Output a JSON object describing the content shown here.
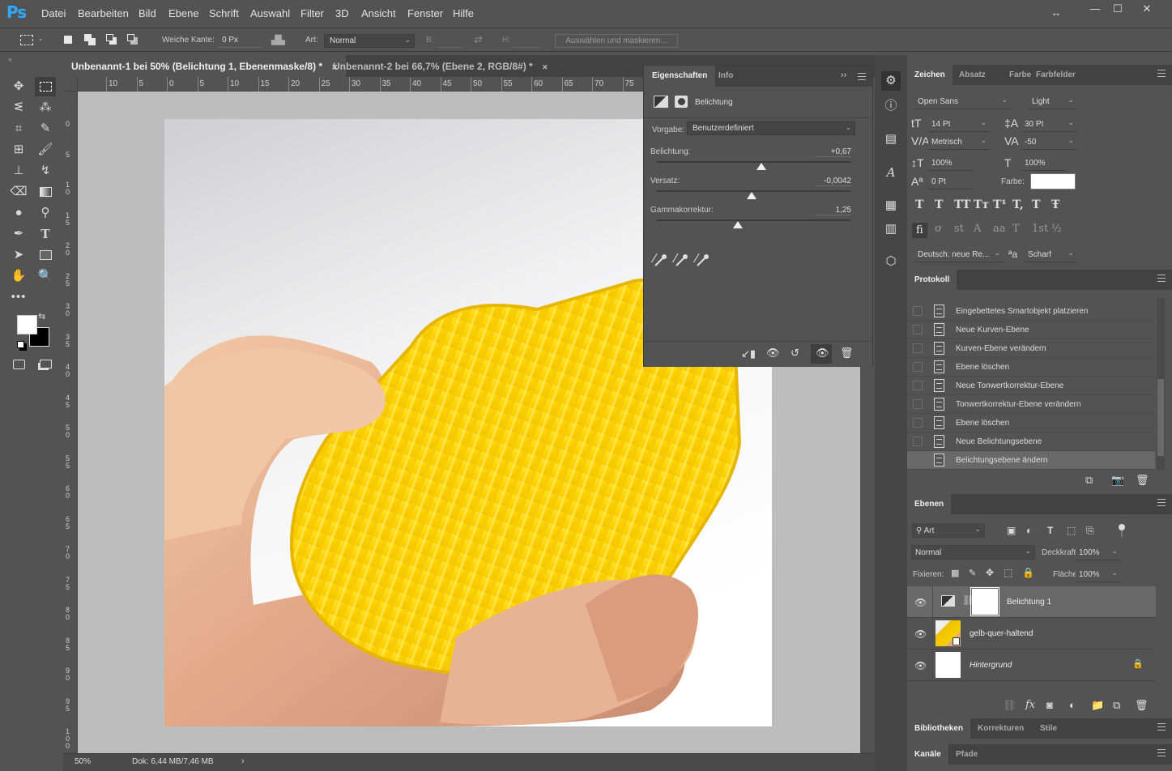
{
  "app": {
    "logo": "Ps"
  },
  "menu": [
    "Datei",
    "Bearbeiten",
    "Bild",
    "Ebene",
    "Schrift",
    "Auswahl",
    "Filter",
    "3D",
    "Ansicht",
    "Fenster",
    "Hilfe"
  ],
  "window_controls": {
    "arrange": "↔",
    "minimize": "—",
    "maximize": "☐",
    "close": "✕"
  },
  "options": {
    "feather_label": "Weiche Kante:",
    "feather_value": "0 Px",
    "style_label": "Art:",
    "style_value": "Normal",
    "width_label": "B:",
    "height_label": "H:",
    "select_mask": "Auswählen und maskieren..."
  },
  "tabs": [
    {
      "label": "Unbenannt-1 bei 50% (Belichtung 1, Ebenenmaske/8) *",
      "close": "✕"
    },
    {
      "label": "Unbenannt-2 bei 66,7% (Ebene 2, RGB/8#) *",
      "close": "✕"
    }
  ],
  "ruler_h": [
    "10",
    "5",
    "0",
    "5",
    "10",
    "15",
    "20",
    "25",
    "30",
    "35",
    "40",
    "45",
    "50",
    "55",
    "60",
    "65",
    "70",
    "75"
  ],
  "ruler_v": [
    "0",
    "5",
    "10",
    "15",
    "20",
    "25",
    "30",
    "35",
    "40",
    "45",
    "50",
    "55",
    "60",
    "65",
    "70",
    "75",
    "80",
    "85",
    "90",
    "95",
    "100"
  ],
  "status": {
    "zoom": "50%",
    "doc": "Dok: 6,44 MB/7,46 MB"
  },
  "properties": {
    "tabs": [
      "Eigenschaften",
      "Info"
    ],
    "title": "Belichtung",
    "preset_label": "Vorgabe:",
    "preset_value": "Benutzerdefiniert",
    "sliders": [
      {
        "label": "Belichtung:",
        "value": "+0,67",
        "pos": 0.54
      },
      {
        "label": "Versatz:",
        "value": "-0,0042",
        "pos": 0.49
      },
      {
        "label": "Gammakorrektur:",
        "value": "1,25",
        "pos": 0.42
      }
    ]
  },
  "character": {
    "tabs": [
      "Zeichen",
      "Absatz",
      "Farbe",
      "Farbfelder"
    ],
    "font": "Open Sans",
    "style": "Light",
    "size": "14 Pt",
    "leading": "30 Pt",
    "kerning": "Metrisch",
    "tracking": "-50",
    "vscale": "100%",
    "hscale": "100%",
    "baseline": "0 Pt",
    "color_label": "Farbe:",
    "language": "Deutsch: neue Re...",
    "aa_icon": "ªa",
    "antialias": "Scharf",
    "type_buttons": [
      "T",
      "T",
      "TT",
      "Tт",
      "T¹",
      "T,",
      "T",
      "Ŧ"
    ],
    "otf_buttons": [
      "fi",
      "ơ",
      "st",
      "A",
      "aa",
      "T",
      "1st",
      "½"
    ]
  },
  "history": {
    "tab": "Protokoll",
    "items": [
      "Eingebettetes Smartobjekt platzieren",
      "Neue Kurven-Ebene",
      "Kurven-Ebene verändern",
      "Ebene löschen",
      "Neue Tonwertkorrektur-Ebene",
      "Tonwertkorrektur-Ebene verändern",
      "Ebene löschen",
      "Neue Belichtungsebene",
      "Belichtungsebene ändern"
    ]
  },
  "layers": {
    "tab": "Ebenen",
    "filter": "Art",
    "blend": "Normal",
    "opacity_label": "Deckkraft:",
    "opacity": "100%",
    "lock_label": "Fixieren:",
    "fill_label": "Fläche:",
    "fill": "100%",
    "items": [
      {
        "name": "Belichtung 1"
      },
      {
        "name": "gelb-quer-haltend"
      },
      {
        "name": "Hintergrund"
      }
    ]
  },
  "bottom_tabs1": [
    "Bibliotheken",
    "Korrekturen",
    "Stile"
  ],
  "bottom_tabs2": [
    "Kanäle",
    "Pfade"
  ]
}
